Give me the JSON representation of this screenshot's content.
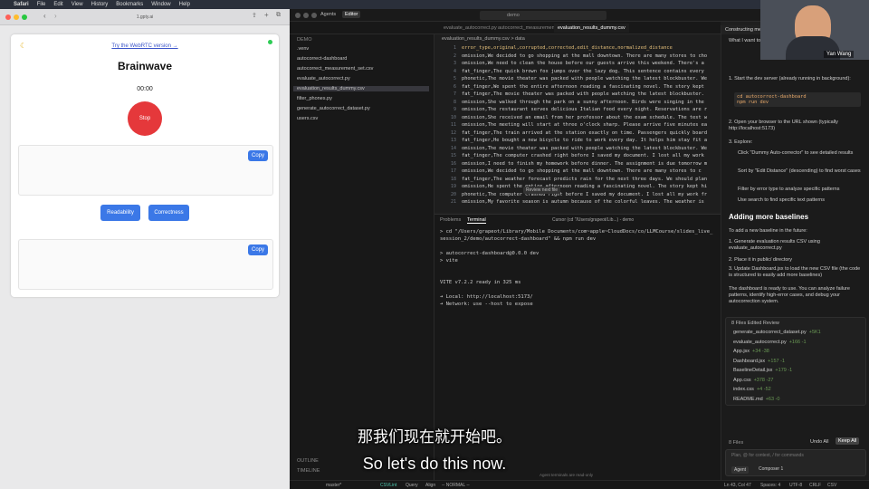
{
  "menubar": {
    "app": "Safari",
    "items": [
      "File",
      "Edit",
      "View",
      "History",
      "Bookmarks",
      "Window",
      "Help"
    ]
  },
  "browser": {
    "url": "1.gpty.ai",
    "webrtc_link": "Try the WebRTC version →",
    "title": "Brainwave",
    "timer": "00:00",
    "stop_label": "Stop",
    "copy_label_1": "Copy",
    "copy_label_2": "Copy",
    "readability_label": "Readability",
    "correctness_label": "Correctness"
  },
  "editor": {
    "tabs": [
      "Agents",
      "Editor"
    ],
    "search": "demo",
    "open_tabs": [
      "evaluate_autocorrect.py",
      "autocorrect_measurement_set.csv",
      "evaluation_results_dummy.csv"
    ],
    "breadcrumb": "evaluation_results_dummy.csv  > data",
    "explorer_header": "DEMO",
    "tree": [
      ".venv",
      "autocorrect-dashboard",
      "autocorrect_measurement_set.csv",
      "evaluate_autocorrect.py",
      "evaluation_results_dummy.csv",
      "filter_phones.py",
      "generate_autocorrect_dataset.py",
      "users.csv"
    ],
    "outline": "OUTLINE",
    "timeline": "TIMELINE",
    "code_lines": [
      "error_type,original,corrupted,corrected,edit_distance,normalized_distance",
      "omission,We decided to go shopping at the mall downtown. There are many stores to cho",
      "omission,We need to clean the house before our guests arrive this weekend. There's a",
      "fat_finger,The quick brown fox jumps over the lazy dog. This sentence contains every",
      "phonetic,The movie theater was packed with people watching the latest blockbuster. We",
      "fat_finger,We spent the entire afternoon reading a fascinating novel. The story kept",
      "fat_finger,The movie theater was packed with people watching the latest blockbuster.",
      "omission,She walked through the park on a sunny afternoon. Birds were singing in the",
      "omission,The restaurant serves delicious Italian food every night. Reservations are r",
      "omission,She received an email from her professor about the exam schedule. The test w",
      "omission,The meeting will start at three o'clock sharp. Please arrive five minutes ea",
      "fat_finger,The train arrived at the station exactly on time. Passengers quickly board",
      "fat_finger,He bought a new bicycle to ride to work every day. It helps him stay fit a",
      "omission,The movie theater was packed with people watching the latest blockbuster. We",
      "fat_finger,The computer crashed right before I saved my document. I lost all my work",
      "omission,I need to finish my homework before dinner. The assignment is due tomorrow m",
      "omission,We decided to go shopping at the mall downtown. There are many stores to c",
      "fat_finger,The weather forecast predicts rain for the next three days. We should plan",
      "omission,He spent the entire afternoon reading a fascinating novel. The story kept hi",
      "phonetic,The computer crashed right before I saved my document. I lost all my work fr",
      "omission,My favorite season is autumn because of the colorful leaves. The weather is"
    ],
    "panel_tabs": [
      "Problems",
      "Terminal"
    ],
    "terminal_title": "Cursor (cd \"/Users/grapeot/Lib...) - demo",
    "terminal_lines": [
      "> cd \"/Users/grapeot/Library/Mobile Documents/com~apple~CloudDocs/co/LLMCourse/slides_live_",
      "session_2/demo/autocorrect-dashboard\" && npm run dev",
      "",
      "> autocorrect-dashboard@0.0.0 dev",
      "> vite",
      "",
      "",
      "  VITE v7.2.2  ready in 325 ms",
      "",
      "  ➜  Local:   http://localhost:5173/",
      "  ➜  Network: use --host to expose"
    ],
    "review_hint": "Review next file",
    "status_left": "master*",
    "status_items": [
      "CSVLint",
      "Query",
      "Align",
      "-- NORMAL --"
    ],
    "status_right": [
      "Ln 43, Col 47",
      "Spaces: 4",
      "UTF-8",
      "CRLF",
      "CSV"
    ],
    "terminal_readonly": "Agent terminals are read-only"
  },
  "chat": {
    "header": "Constructing measu",
    "intro": "What I want to bui React. It will show baselines. Now, I",
    "step1": "1. Start the dev server (already running in background):",
    "step1_code": "cd autocorrect-dashboard\nnpm run dev",
    "step2": "2. Open your browser to the URL shown (typically http://localhost:5173)",
    "step3": "3. Explore:",
    "bullets": [
      "Click \"Dummy Auto-corrector\" to see detailed results",
      "Sort by \"Edit Distance\" (descending) to find worst cases",
      "Filter by error type to analyze specific patterns",
      "Use search to find specific text patterns"
    ],
    "heading": "Adding more baselines",
    "add_intro": "To add a new baseline in the future:",
    "add_steps": [
      "1. Generate evaluation results CSV using evaluate_autocorrect.py",
      "2. Place it in public/ directory",
      "3. Update Dashboard.jsx to load the new CSV file (the code is structured to easily add more baselines)"
    ],
    "outro": "The dashboard is ready to use. You can analyze failure patterns, identify high-error cases, and debug your autocorrection system.",
    "files_header": "8 Files Edited  Review",
    "files": [
      {
        "name": "generate_autocorrect_dataset.py",
        "delta": "+5K1"
      },
      {
        "name": "evaluate_autocorrect.py",
        "delta": "+166 -1"
      },
      {
        "name": "App.jsx",
        "delta": "+34 -38"
      },
      {
        "name": "Dashboard.jsx",
        "delta": "+157 -1"
      },
      {
        "name": "BaselineDetail.jsx",
        "delta": "+179 -1"
      },
      {
        "name": "App.css",
        "delta": "+378 -27"
      },
      {
        "name": "index.css",
        "delta": "+4 -52"
      },
      {
        "name": "README.md",
        "delta": "+63 -0"
      }
    ],
    "files_footer": "8 Files",
    "undo_all": "Undo All",
    "keep_all": "Keep All",
    "input_placeholder": "Plan, @ for context, / for commands",
    "agent_label": "Agent",
    "model_label": "Composer 1"
  },
  "webcam": {
    "name": "Yan Wang"
  },
  "subtitles": {
    "cn": "那我们现在就开始吧。",
    "en": "So let's do this now."
  },
  "colors": {
    "stop": "#e5383b",
    "blue": "#3b78e7"
  }
}
